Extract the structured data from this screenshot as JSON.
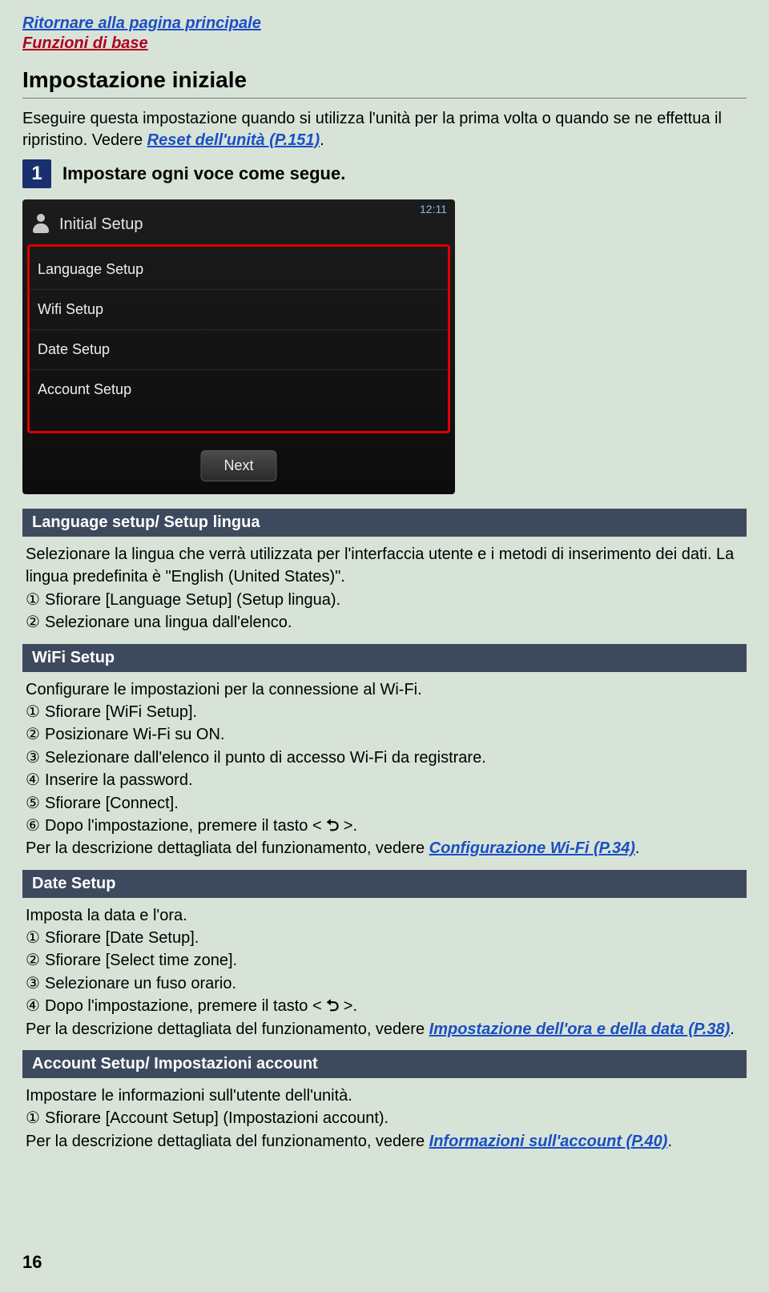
{
  "nav": {
    "home_link": "Ritornare alla pagina principale",
    "section_label": "Funzioni di base"
  },
  "heading": "Impostazione iniziale",
  "intro": {
    "text_before": "Eseguire questa impostazione quando si utilizza l'unità per la prima volta o quando se ne effettua il ripristino. Vedere ",
    "link_text": "Reset dell'unità (P.151)",
    "text_after": "."
  },
  "step1": {
    "num": "1",
    "label": "Impostare ogni voce come segue."
  },
  "device": {
    "time": "12:11",
    "title": "Initial Setup",
    "items": [
      "Language Setup",
      "Wifi Setup",
      "Date Setup",
      "Account Setup"
    ],
    "next_label": "Next"
  },
  "sections": {
    "language": {
      "title": "Language setup/ Setup lingua",
      "desc": "Selezionare la lingua che verrà utilizzata per l'interfaccia utente e i metodi di inserimento dei dati. La lingua predefinita è \"English (United States)\".",
      "s1": "Sfiorare [Language Setup] (Setup lingua).",
      "s2": "Selezionare una lingua dall'elenco."
    },
    "wifi": {
      "title": "WiFi Setup",
      "desc": "Configurare le impostazioni per la connessione al Wi-Fi.",
      "s1": "Sfiorare [WiFi Setup].",
      "s2": "Posizionare Wi-Fi su ON.",
      "s3": "Selezionare dall'elenco il punto di accesso Wi-Fi da registrare.",
      "s4": "Inserire la password.",
      "s5": "Sfiorare [Connect].",
      "s6_before": "Dopo l'impostazione, premere il tasto < ",
      "s6_after": " >.",
      "footer_before": "Per la descrizione dettagliata del funzionamento, vedere ",
      "footer_link": "Configurazione Wi-Fi (P.34)",
      "footer_after": "."
    },
    "date": {
      "title": "Date Setup",
      "desc": "Imposta la data e l'ora.",
      "s1": "Sfiorare [Date Setup].",
      "s2": "Sfiorare [Select time zone].",
      "s3": "Selezionare un fuso orario.",
      "s4_before": "Dopo l'impostazione, premere il tasto < ",
      "s4_after": " >.",
      "footer_before": "Per la descrizione dettagliata del funzionamento, vedere ",
      "footer_link": "Impostazione dell'ora e della data (P.38)",
      "footer_after": "."
    },
    "account": {
      "title": "Account Setup/ Impostazioni account",
      "desc": "Impostare le informazioni sull'utente dell'unità.",
      "s1": "Sfiorare [Account Setup] (Impostazioni account).",
      "footer_before": "Per la descrizione dettagliata del funzionamento, vedere ",
      "footer_link": "Informazioni sull'account (P.40)",
      "footer_after": "."
    }
  },
  "glyphs": {
    "c1": "①",
    "c2": "②",
    "c3": "③",
    "c4": "④",
    "c5": "⑤",
    "c6": "⑥",
    "return": "⮌"
  },
  "page_number": "16"
}
